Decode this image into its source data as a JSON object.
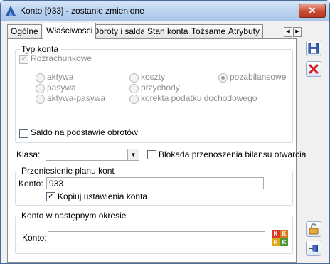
{
  "window": {
    "title": "Konto [933] - zostanie zmienione",
    "close_label": "✕"
  },
  "tabs": [
    {
      "label": "Ogólne"
    },
    {
      "label": "Właściwości"
    },
    {
      "label": "Obroty i salda"
    },
    {
      "label": "Stan konta"
    },
    {
      "label": "Tożsame"
    },
    {
      "label": "Atrybuty"
    }
  ],
  "tab_scroll": {
    "left": "◀",
    "right": "▶"
  },
  "typ_konta": {
    "title": "Typ konta",
    "rozrachunkowe": "Rozrachunkowe",
    "options": {
      "aktywa": "aktywa",
      "pasywa": "pasywa",
      "aktywa_pasywa": "aktywa-pasywa",
      "koszty": "koszty",
      "przychody": "przychody",
      "korekta": "korekta podatku dochodowego",
      "pozabilansowe": "pozabilansowe"
    },
    "selected": "pozabilansowe",
    "saldo": "Saldo na podstawie obrotów"
  },
  "klasa": {
    "label": "Klasa:",
    "value": ""
  },
  "blokada": "Blokada przenoszenia bilansu otwarcia",
  "przeniesienie": {
    "title": "Przeniesienie planu kont",
    "konto_label": "Konto:",
    "konto_value": "933",
    "kopiuj": "Kopiuj ustawienia konta",
    "kopiuj_checked": true
  },
  "nastepny": {
    "title": "Konto w następnym okresie",
    "konto_label": "Konto:",
    "konto_value": ""
  },
  "icons": {
    "check_mark": "✓",
    "combo_arrow": "▼",
    "kk_letter": "K"
  },
  "colors": {
    "kk1": "#d43a2a",
    "kk2": "#d47a1a",
    "kk3": "#e0a81a",
    "kk4": "#4a9a3a"
  }
}
